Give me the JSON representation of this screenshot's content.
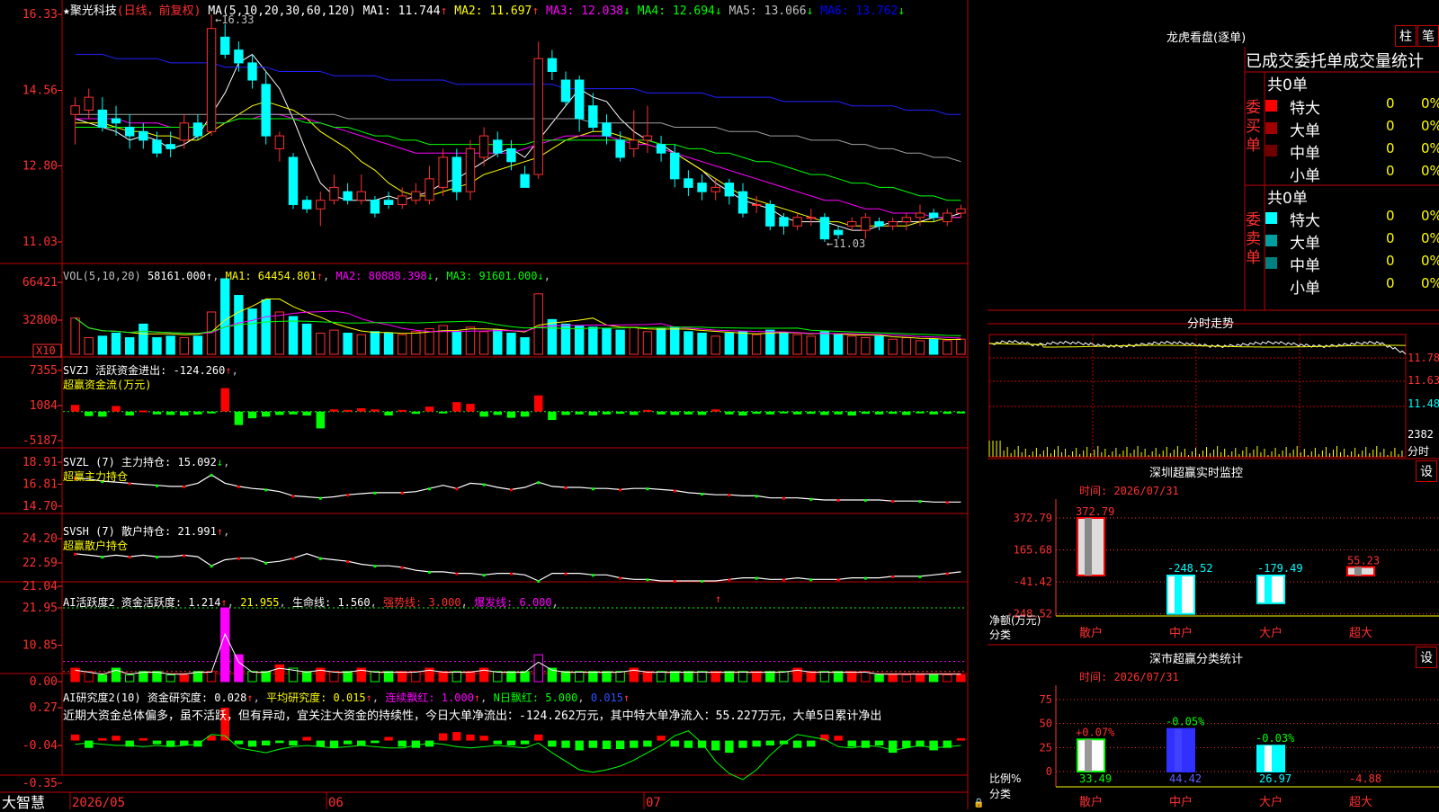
{
  "main_chart": {
    "stock_name": "★聚光科技",
    "mode": "(日线，前复权)",
    "ma_header": "MA(5,10,20,30,60,120)",
    "ma": [
      {
        "label": "MA1: 11.744",
        "arrow": "↑",
        "color": "#ffffff"
      },
      {
        "label": "MA2: 11.697",
        "arrow": "↑",
        "color": "#ffff00"
      },
      {
        "label": "MA3: 12.038",
        "arrow": "↓",
        "color": "#ff00ff"
      },
      {
        "label": "MA4: 12.694",
        "arrow": "↓",
        "color": "#00ff00"
      },
      {
        "label": "MA5: 13.066",
        "arrow": "↓",
        "color": "#c0c0c0"
      },
      {
        "label": "MA6: 13.762",
        "arrow": "↓",
        "color": "#0000ff"
      }
    ],
    "y_ticks": [
      "16.33",
      "14.56",
      "12.80",
      "11.03"
    ],
    "high_note": "16.33",
    "low_note": "11.03",
    "x_dates": [
      "2026/05",
      "06",
      "07"
    ]
  },
  "candles": [
    [
      14.0,
      14.2,
      13.3,
      14.4
    ],
    [
      14.1,
      14.4,
      13.9,
      14.6
    ],
    [
      14.1,
      13.7,
      13.6,
      14.4
    ],
    [
      13.9,
      13.8,
      13.5,
      14.2
    ],
    [
      13.7,
      13.5,
      13.2,
      14.0
    ],
    [
      13.6,
      13.4,
      13.2,
      13.8
    ],
    [
      13.4,
      13.1,
      13.0,
      13.6
    ],
    [
      13.3,
      13.2,
      13.0,
      13.6
    ],
    [
      13.4,
      13.8,
      13.2,
      14.0
    ],
    [
      13.8,
      13.5,
      13.4,
      14.0
    ],
    [
      13.6,
      16.0,
      13.5,
      16.33
    ],
    [
      15.8,
      15.4,
      15.3,
      16.1
    ],
    [
      15.5,
      15.2,
      15.0,
      15.7
    ],
    [
      15.2,
      14.8,
      14.6,
      15.4
    ],
    [
      14.7,
      13.5,
      13.3,
      15.0
    ],
    [
      13.2,
      13.5,
      12.9,
      13.6
    ],
    [
      13.0,
      11.9,
      11.8,
      13.1
    ],
    [
      12.0,
      11.8,
      11.7,
      12.1
    ],
    [
      11.8,
      12.0,
      11.4,
      12.2
    ],
    [
      12.0,
      12.3,
      11.9,
      12.6
    ],
    [
      12.2,
      12.0,
      11.9,
      12.4
    ],
    [
      12.0,
      12.2,
      11.9,
      12.6
    ],
    [
      12.0,
      11.7,
      11.6,
      12.1
    ],
    [
      12.0,
      11.9,
      11.8,
      12.2
    ],
    [
      11.9,
      12.1,
      11.8,
      12.3
    ],
    [
      12.0,
      12.2,
      11.9,
      12.4
    ],
    [
      12.0,
      12.5,
      11.9,
      12.8
    ],
    [
      12.3,
      13.0,
      12.1,
      13.2
    ],
    [
      13.0,
      12.2,
      12.0,
      13.2
    ],
    [
      12.2,
      13.2,
      12.0,
      13.4
    ],
    [
      13.0,
      13.5,
      12.8,
      13.7
    ],
    [
      13.4,
      13.1,
      13.0,
      13.6
    ],
    [
      13.2,
      12.9,
      12.7,
      13.4
    ],
    [
      12.6,
      12.3,
      12.3,
      12.8
    ],
    [
      12.6,
      15.3,
      12.5,
      15.7
    ],
    [
      15.3,
      15.0,
      14.8,
      15.5
    ],
    [
      14.8,
      14.3,
      14.2,
      15.0
    ],
    [
      14.8,
      13.9,
      13.6,
      14.9
    ],
    [
      14.2,
      13.7,
      13.6,
      14.5
    ],
    [
      13.8,
      13.5,
      13.3,
      14.0
    ],
    [
      13.4,
      13.0,
      12.9,
      13.6
    ],
    [
      13.2,
      13.4,
      13.0,
      14.1
    ],
    [
      13.4,
      13.5,
      13.1,
      14.2
    ],
    [
      13.3,
      13.1,
      12.9,
      13.5
    ],
    [
      13.1,
      12.5,
      12.3,
      13.3
    ],
    [
      12.5,
      12.3,
      12.1,
      12.7
    ],
    [
      12.4,
      12.2,
      12.0,
      12.6
    ],
    [
      12.2,
      12.3,
      12.0,
      12.5
    ],
    [
      12.4,
      12.1,
      11.9,
      12.5
    ],
    [
      12.2,
      11.7,
      11.6,
      12.4
    ],
    [
      11.9,
      11.9,
      11.7,
      12.1
    ],
    [
      11.9,
      11.4,
      11.3,
      12.0
    ],
    [
      11.6,
      11.4,
      11.2,
      11.7
    ],
    [
      11.4,
      11.6,
      11.3,
      11.7
    ],
    [
      11.6,
      11.6,
      11.4,
      11.8
    ],
    [
      11.6,
      11.1,
      11.03,
      11.7
    ],
    [
      11.3,
      11.2,
      11.1,
      11.4
    ],
    [
      11.4,
      11.5,
      11.3,
      11.6
    ],
    [
      11.3,
      11.6,
      11.1,
      11.7
    ],
    [
      11.5,
      11.4,
      11.3,
      11.6
    ],
    [
      11.4,
      11.5,
      11.3,
      11.6
    ],
    [
      11.5,
      11.6,
      11.3,
      11.7
    ],
    [
      11.6,
      11.7,
      11.4,
      11.9
    ],
    [
      11.7,
      11.6,
      11.5,
      11.8
    ],
    [
      11.5,
      11.7,
      11.4,
      11.8
    ],
    [
      11.7,
      11.8,
      11.6,
      11.9
    ]
  ],
  "ma_lines": {
    "ma5": [
      13.9,
      13.8,
      13.7,
      13.6,
      13.4,
      13.5,
      13.4,
      13.2,
      13.3,
      13.5,
      14.0,
      14.5,
      15.2,
      15.4,
      15.0,
      14.6,
      13.9,
      13.1,
      12.4,
      12.1,
      12.0,
      12.0,
      12.0,
      12.1,
      12.0,
      12.1,
      12.2,
      12.4,
      12.5,
      12.7,
      12.9,
      13.1,
      13.2,
      13.0,
      13.4,
      13.8,
      14.2,
      14.6,
      14.4,
      14.3,
      13.9,
      13.6,
      13.4,
      13.3,
      13.1,
      12.9,
      12.7,
      12.4,
      12.2,
      12.0,
      11.9,
      11.8,
      11.6,
      11.5,
      11.5,
      11.5,
      11.4,
      11.3,
      11.3,
      11.4,
      11.5,
      11.5,
      11.5,
      11.6,
      11.6,
      11.7
    ],
    "ma10": [
      13.8,
      13.8,
      13.8,
      13.7,
      13.6,
      13.6,
      13.5,
      13.5,
      13.4,
      13.4,
      13.6,
      13.8,
      14.0,
      14.2,
      14.3,
      14.2,
      14.1,
      13.9,
      13.6,
      13.4,
      13.2,
      12.9,
      12.7,
      12.4,
      12.2,
      12.1,
      12.1,
      12.2,
      12.3,
      12.4,
      12.6,
      12.7,
      12.8,
      12.9,
      13.0,
      13.2,
      13.4,
      13.5,
      13.6,
      13.6,
      13.5,
      13.4,
      13.3,
      13.2,
      13.1,
      12.9,
      12.7,
      12.5,
      12.3,
      12.1,
      12.0,
      11.9,
      11.8,
      11.7,
      11.6,
      11.5,
      11.5,
      11.4,
      11.4,
      11.4,
      11.4,
      11.4,
      11.5,
      11.5,
      11.6,
      11.6
    ],
    "ma20": [
      13.9,
      13.9,
      13.9,
      13.9,
      13.8,
      13.8,
      13.8,
      13.7,
      13.7,
      13.7,
      13.8,
      13.8,
      13.9,
      13.9,
      14.0,
      14.0,
      13.9,
      13.9,
      13.8,
      13.7,
      13.6,
      13.5,
      13.4,
      13.3,
      13.2,
      13.1,
      13.1,
      13.1,
      13.1,
      13.1,
      13.1,
      13.1,
      13.1,
      13.2,
      13.3,
      13.4,
      13.5,
      13.5,
      13.5,
      13.5,
      13.4,
      13.3,
      13.3,
      13.2,
      13.1,
      13.0,
      12.9,
      12.8,
      12.7,
      12.6,
      12.5,
      12.4,
      12.3,
      12.2,
      12.1,
      12.0,
      12.0,
      11.9,
      11.8,
      11.8,
      11.7,
      11.7,
      11.7,
      11.6,
      11.6,
      11.6
    ],
    "ma30": [
      13.7,
      13.7,
      13.7,
      13.7,
      13.7,
      13.7,
      13.7,
      13.7,
      13.7,
      13.7,
      13.8,
      13.8,
      13.9,
      13.9,
      13.9,
      13.9,
      13.9,
      13.8,
      13.8,
      13.7,
      13.7,
      13.6,
      13.5,
      13.5,
      13.4,
      13.4,
      13.3,
      13.3,
      13.3,
      13.3,
      13.3,
      13.3,
      13.3,
      13.3,
      13.4,
      13.4,
      13.4,
      13.4,
      13.4,
      13.4,
      13.4,
      13.4,
      13.4,
      13.3,
      13.3,
      13.2,
      13.2,
      13.1,
      13.1,
      13.0,
      12.9,
      12.9,
      12.8,
      12.7,
      12.6,
      12.6,
      12.5,
      12.4,
      12.4,
      12.3,
      12.3,
      12.2,
      12.1,
      12.1,
      12.0,
      12.0
    ],
    "ma60": [
      14.0,
      14.0,
      14.0,
      14.0,
      14.0,
      14.0,
      14.0,
      14.0,
      14.0,
      14.0,
      14.0,
      14.0,
      14.0,
      14.0,
      14.0,
      14.0,
      14.0,
      14.0,
      14.0,
      14.0,
      13.9,
      13.9,
      13.9,
      13.9,
      13.9,
      13.9,
      13.9,
      13.9,
      13.9,
      13.9,
      13.9,
      13.9,
      13.9,
      13.9,
      13.9,
      13.9,
      13.9,
      13.9,
      13.8,
      13.8,
      13.8,
      13.8,
      13.8,
      13.8,
      13.7,
      13.7,
      13.7,
      13.7,
      13.6,
      13.6,
      13.6,
      13.5,
      13.5,
      13.5,
      13.4,
      13.4,
      13.4,
      13.3,
      13.3,
      13.2,
      13.2,
      13.1,
      13.1,
      13.0,
      13.0,
      12.9
    ],
    "ma120": [
      15.4,
      15.4,
      15.4,
      15.3,
      15.3,
      15.3,
      15.3,
      15.2,
      15.2,
      15.2,
      15.2,
      15.1,
      15.1,
      15.1,
      15.1,
      15.0,
      15.0,
      15.0,
      15.0,
      14.9,
      14.9,
      14.9,
      14.9,
      14.8,
      14.8,
      14.8,
      14.8,
      14.8,
      14.7,
      14.7,
      14.7,
      14.7,
      14.7,
      14.7,
      14.7,
      14.7,
      14.6,
      14.6,
      14.6,
      14.6,
      14.6,
      14.6,
      14.5,
      14.5,
      14.5,
      14.5,
      14.5,
      14.4,
      14.4,
      14.4,
      14.4,
      14.4,
      14.3,
      14.3,
      14.3,
      14.3,
      14.3,
      14.2,
      14.2,
      14.2,
      14.2,
      14.1,
      14.1,
      14.1,
      14.0,
      14.0
    ]
  },
  "volume_panel": {
    "header": "VOL(5,10,20)",
    "v0": "58161.000",
    "ma": [
      {
        "label": "MA1: 64454.801",
        "arrow": "↑",
        "color": "#ffff00"
      },
      {
        "label": "MA2: 80888.398",
        "arrow": "↓",
        "color": "#ff00ff"
      },
      {
        "label": "MA3: 91601.000",
        "arrow": "↓",
        "color": "#00ff00"
      }
    ],
    "y_ticks": [
      "66421",
      "32800"
    ],
    "unit": "X10"
  },
  "volumes": [
    48,
    22,
    24,
    28,
    22,
    40,
    22,
    24,
    22,
    24,
    56,
    100,
    78,
    60,
    72,
    56,
    50,
    40,
    28,
    32,
    28,
    26,
    30,
    28,
    26,
    30,
    34,
    38,
    30,
    36,
    30,
    32,
    28,
    22,
    80,
    46,
    40,
    38,
    36,
    34,
    32,
    36,
    30,
    34,
    36,
    30,
    28,
    24,
    28,
    30,
    26,
    32,
    28,
    26,
    24,
    30,
    26,
    24,
    22,
    24,
    20,
    22,
    18,
    20,
    18,
    20
  ],
  "svzj": {
    "header": "SVZJ  活跃资金进出: -124.260",
    "arrow": "↑",
    "sub": "超赢资金流(万元)",
    "y_ticks": [
      "7355",
      "1084",
      "-5187"
    ],
    "values": [
      1200,
      -800,
      -900,
      1000,
      -700,
      200,
      -500,
      -600,
      -700,
      -500,
      -300,
      4200,
      -2400,
      -1200,
      -900,
      -600,
      -500,
      -700,
      -3000,
      400,
      300,
      600,
      400,
      -700,
      300,
      -400,
      900,
      -300,
      1700,
      1400,
      -900,
      -600,
      -1100,
      -900,
      2900,
      -1500,
      -600,
      -500,
      -700,
      -500,
      -400,
      -600,
      300,
      -500,
      -600,
      -500,
      -600,
      400,
      -500,
      -700,
      -400,
      -500,
      -300,
      -500,
      -400,
      -600,
      -500,
      -700,
      -400,
      -500,
      -400,
      -600,
      -300,
      -500,
      -400,
      -300
    ]
  },
  "svzl": {
    "header": "SVZL  (7)  主力持仓: 15.092",
    "arrow": "↓",
    "sub": "超赢主力持仓",
    "y_ticks": [
      "18.91",
      "16.81",
      "14.70"
    ],
    "values": [
      17.4,
      17.3,
      17.1,
      17.0,
      16.9,
      16.8,
      16.7,
      16.6,
      16.6,
      16.9,
      17.7,
      16.9,
      16.6,
      16.4,
      16.3,
      16.1,
      15.7,
      15.6,
      15.5,
      15.6,
      15.8,
      15.9,
      16.0,
      16.0,
      16.0,
      16.1,
      16.4,
      16.7,
      16.4,
      16.9,
      16.8,
      16.5,
      16.3,
      16.5,
      17.0,
      16.6,
      16.5,
      16.5,
      16.4,
      16.4,
      16.3,
      16.4,
      16.4,
      16.3,
      16.2,
      16.0,
      15.9,
      15.8,
      15.8,
      15.7,
      15.7,
      15.5,
      15.5,
      15.5,
      15.4,
      15.3,
      15.3,
      15.3,
      15.3,
      15.3,
      15.2,
      15.2,
      15.2,
      15.1,
      15.1,
      15.1
    ]
  },
  "svsh": {
    "header": "SVSH  (7)  散户持仓: 21.991",
    "arrow": "↑",
    "sub": "超赢散户持仓",
    "y_ticks": [
      "24.20",
      "22.59",
      "21.04"
    ],
    "values": [
      23.2,
      23.1,
      23.0,
      23.1,
      23.0,
      23.1,
      23.0,
      23.0,
      23.1,
      23.0,
      22.4,
      22.8,
      22.9,
      22.9,
      22.6,
      22.7,
      22.9,
      23.2,
      22.9,
      22.8,
      22.7,
      22.5,
      22.4,
      22.4,
      22.3,
      22.1,
      22.0,
      22.0,
      21.9,
      21.9,
      21.8,
      21.9,
      21.9,
      21.8,
      21.4,
      21.9,
      21.9,
      21.9,
      21.8,
      21.8,
      21.6,
      21.5,
      21.5,
      21.4,
      21.4,
      21.4,
      21.4,
      21.4,
      21.5,
      21.6,
      21.6,
      21.5,
      21.5,
      21.6,
      21.5,
      21.5,
      21.5,
      21.6,
      21.6,
      21.6,
      21.7,
      21.7,
      21.7,
      21.8,
      21.9,
      22.0
    ]
  },
  "ai_active": {
    "header1": "AI活跃度2",
    "label_active": "资金活跃度: 1.214",
    "val2": "21.955",
    "life": "生命线: 1.560",
    "strong": "强势线: 3.000",
    "burst": "爆发线: 6.000",
    "y_ticks": [
      "21.95",
      "10.85",
      "0.00"
    ],
    "values": [
      4,
      3,
      2,
      4,
      2,
      3,
      3,
      2,
      2,
      3,
      3,
      21.95,
      8,
      3,
      3,
      5,
      4,
      3,
      4,
      3,
      3,
      4,
      3,
      3,
      3,
      3,
      4,
      3,
      3,
      3,
      4,
      3,
      3,
      3,
      8,
      4,
      3,
      3,
      3,
      3,
      3,
      4,
      3,
      3,
      3,
      3,
      3,
      3,
      3,
      3,
      3,
      3,
      3,
      4,
      3,
      3,
      3,
      3,
      3,
      2,
      2,
      2,
      2,
      2,
      2,
      2
    ]
  },
  "ai_research": {
    "header": "AI研究度2(10)",
    "label1": "资金研究度: 0.028",
    "label2": "平均研究度: 0.015",
    "label3": "连续飘红: 1.000",
    "label4": "N日飘红: 5.000",
    "label5": "0.015",
    "comment": "近期大资金总体偏多，虽不活跃，但有异动，宜关注大资金的持续性，今日大单净流出：-124.262万元，其中特大单净流入：55.227万元，大单5日累计净出",
    "y_ticks": [
      "0.27",
      "-0.04",
      "-0.35"
    ],
    "values": [
      0.05,
      -0.06,
      0.02,
      0.04,
      -0.05,
      0.02,
      -0.03,
      -0.05,
      -0.04,
      -0.05,
      0.04,
      0.27,
      -0.03,
      -0.05,
      -0.04,
      -0.02,
      -0.04,
      0.03,
      -0.05,
      -0.06,
      -0.03,
      -0.04,
      -0.02,
      0.03,
      -0.05,
      -0.06,
      -0.05,
      0.06,
      0.07,
      0.05,
      0.04,
      -0.03,
      -0.04,
      -0.03,
      0.05,
      -0.05,
      -0.06,
      -0.08,
      -0.06,
      -0.07,
      -0.07,
      -0.06,
      -0.05,
      0.04,
      -0.05,
      -0.06,
      -0.06,
      -0.08,
      -0.1,
      -0.06,
      -0.05,
      -0.04,
      -0.03,
      -0.06,
      -0.05,
      0.05,
      0.04,
      -0.05,
      -0.06,
      -0.04,
      -0.1,
      -0.06,
      -0.05,
      -0.08,
      -0.06,
      0.02
    ],
    "line": [
      -0.03,
      -0.02,
      -0.03,
      -0.04,
      -0.04,
      -0.05,
      -0.04,
      -0.05,
      -0.04,
      -0.03,
      0.05,
      0.04,
      -0.06,
      -0.08,
      -0.1,
      -0.07,
      -0.05,
      -0.04,
      -0.05,
      -0.06,
      -0.05,
      -0.04,
      -0.05,
      -0.06,
      -0.06,
      -0.04,
      -0.02,
      -0.03,
      -0.05,
      -0.06,
      -0.05,
      -0.04,
      -0.05,
      -0.06,
      -0.02,
      -0.1,
      -0.17,
      -0.24,
      -0.26,
      -0.24,
      -0.21,
      -0.16,
      -0.1,
      -0.04,
      0.04,
      0.08,
      -0.02,
      -0.17,
      -0.27,
      -0.32,
      -0.24,
      -0.12,
      -0.02,
      0.05,
      0.03,
      0.01,
      -0.05,
      -0.06,
      -0.04,
      -0.05,
      -0.08,
      -0.06,
      -0.04,
      -0.06,
      -0.05,
      -0.04
    ]
  },
  "order_panel": {
    "title": "龙虎看盘(逐单)",
    "btn1": "柱",
    "btn2": "笔",
    "heading": "已成交委托单成交量统计",
    "buy_side": "委买单",
    "sell_side": "委卖单",
    "buy_total": "共0单",
    "sell_total": "共0单",
    "buy_rows": [
      {
        "label": "特大",
        "count": "0",
        "pct": "0%",
        "color": "#ff0000"
      },
      {
        "label": "大单",
        "count": "0",
        "pct": "0%",
        "color": "#a00000"
      },
      {
        "label": "中单",
        "count": "0",
        "pct": "0%",
        "color": "#700000"
      },
      {
        "label": "小单",
        "count": "0",
        "pct": "0%",
        "color": "#000000"
      }
    ],
    "sell_rows": [
      {
        "label": "特大",
        "count": "0",
        "pct": "0%",
        "color": "#00ffff"
      },
      {
        "label": "大单",
        "count": "0",
        "pct": "0%",
        "color": "#00a0a0"
      },
      {
        "label": "中单",
        "count": "0",
        "pct": "0%",
        "color": "#008080"
      },
      {
        "label": "小单",
        "count": "0",
        "pct": "0%",
        "color": "#000000"
      }
    ]
  },
  "intraday": {
    "title": "分时走势",
    "prices": [
      "11.78",
      "11.63",
      "11.48"
    ],
    "vol_label": "2382",
    "sub": "分时"
  },
  "monitor": {
    "title": "深圳超赢实时监控",
    "btn": "设",
    "time": "时间: 2026/07/31",
    "y_ticks": [
      "372.79",
      "165.68",
      "-41.42",
      "-248.52"
    ],
    "unit": "净额(万元)",
    "axis": "分类",
    "bars": [
      {
        "cat": "散户",
        "value": 372.79,
        "label": "372.79"
      },
      {
        "cat": "中户",
        "value": -248.52,
        "label": "-248.52"
      },
      {
        "cat": "大户",
        "value": -179.49,
        "label": "-179.49"
      },
      {
        "cat": "超大",
        "value": 55.23,
        "label": "55.23"
      }
    ]
  },
  "classify": {
    "title": "深市超赢分类统计",
    "btn": "设",
    "time": "时间: 2026/07/31",
    "y_ticks": [
      "75",
      "50",
      "25",
      "0"
    ],
    "unit": "比例%",
    "axis": "分类",
    "bars": [
      {
        "cat": "散户",
        "value": 33.49,
        "label": "33.49",
        "delta": "+0.07%",
        "color": "#ffffff"
      },
      {
        "cat": "中户",
        "value": 44.42,
        "label": "44.42",
        "delta": "-0.05%",
        "color": "#3030ff"
      },
      {
        "cat": "大户",
        "value": 26.97,
        "label": "26.97",
        "delta": "-0.03%",
        "color": "#00ffff"
      },
      {
        "cat": "超大",
        "value": -4.88,
        "label": "-4.88",
        "delta": "",
        "color": "#ff0000"
      }
    ]
  },
  "brand": "大智慧"
}
